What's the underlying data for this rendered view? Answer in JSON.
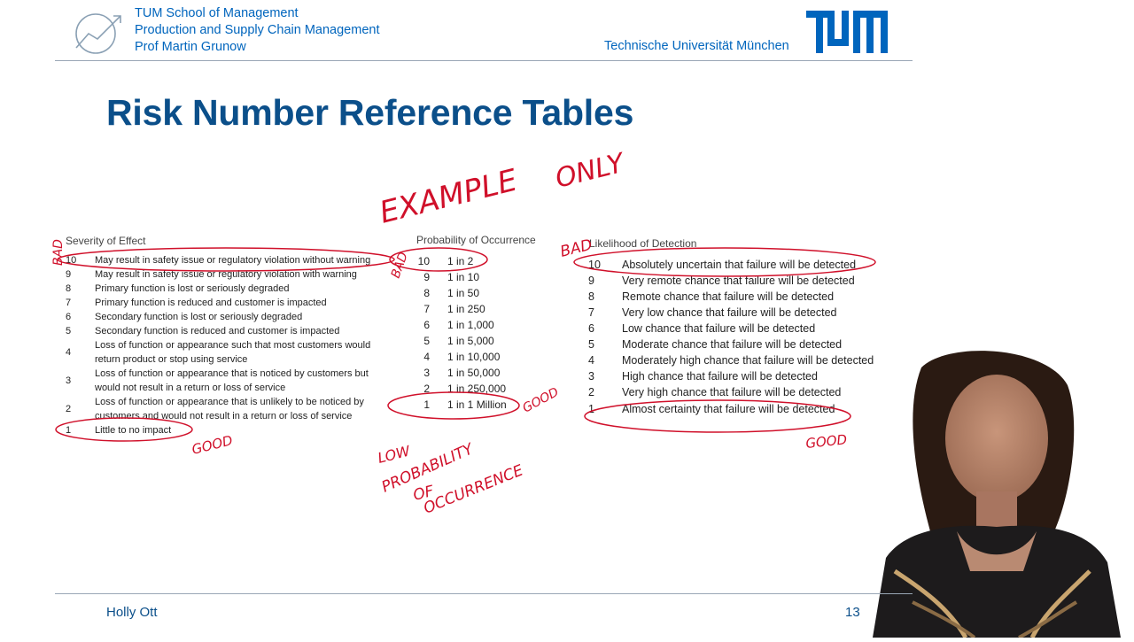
{
  "header": {
    "lines": [
      "TUM School of Management",
      "Production and Supply Chain Management",
      "Prof Martin Grunow"
    ],
    "university": "Technische Universität München",
    "logo_text": "TUM"
  },
  "title": "Risk Number Reference Tables",
  "severity": {
    "heading": "Severity of Effect",
    "rows": [
      {
        "n": "10",
        "t": "May result in safety issue or regulatory violation without warning"
      },
      {
        "n": "9",
        "t": "May result in safety issue or regulatory violation with warning"
      },
      {
        "n": "8",
        "t": "Primary function is lost or seriously degraded"
      },
      {
        "n": "7",
        "t": "Primary function is reduced and customer is impacted"
      },
      {
        "n": "6",
        "t": "Secondary function is lost or seriously degraded"
      },
      {
        "n": "5",
        "t": "Secondary function is reduced and customer is impacted"
      },
      {
        "n": "4",
        "t": "Loss of function or appearance such that most customers would return product or stop using service"
      },
      {
        "n": "3",
        "t": "Loss of function or appearance that is noticed by customers but would not result in a return or loss of service"
      },
      {
        "n": "2",
        "t": "Loss of function or appearance that is unlikely to be noticed by customers and would not result in a return or loss of service"
      },
      {
        "n": "1",
        "t": "Little to no impact"
      }
    ]
  },
  "probability": {
    "heading": "Probability of Occurrence",
    "rows": [
      {
        "n": "10",
        "t": "1 in 2"
      },
      {
        "n": "9",
        "t": "1 in 10"
      },
      {
        "n": "8",
        "t": "1 in 50"
      },
      {
        "n": "7",
        "t": "1 in 250"
      },
      {
        "n": "6",
        "t": "1 in 1,000"
      },
      {
        "n": "5",
        "t": "1 in 5,000"
      },
      {
        "n": "4",
        "t": "1 in 10,000"
      },
      {
        "n": "3",
        "t": "1 in 50,000"
      },
      {
        "n": "2",
        "t": "1 in 250,000"
      },
      {
        "n": "1",
        "t": "1 in 1 Million"
      }
    ]
  },
  "detection": {
    "heading": "Likelihood of Detection",
    "rows": [
      {
        "n": "10",
        "t": "Absolutely uncertain that failure will be detected"
      },
      {
        "n": "9",
        "t": "Very remote chance that failure will be detected"
      },
      {
        "n": "8",
        "t": "Remote chance that failure will be detected"
      },
      {
        "n": "7",
        "t": "Very low chance that failure will be detected"
      },
      {
        "n": "6",
        "t": "Low chance that failure will be detected"
      },
      {
        "n": "5",
        "t": "Moderate chance that failure will be detected"
      },
      {
        "n": "4",
        "t": "Moderately high chance that failure will be detected"
      },
      {
        "n": "3",
        "t": "High chance that failure will be detected"
      },
      {
        "n": "2",
        "t": "Very high chance that failure will be detected"
      },
      {
        "n": "1",
        "t": "Almost certainty that failure will be detected"
      }
    ]
  },
  "annotations": {
    "example_only_1": "EXAMPLE",
    "example_only_2": "ONLY",
    "bad": "BAD",
    "good": "GOOD",
    "low": "LOW",
    "probability": "PROBABILITY",
    "of": "OF",
    "occurrence": "OCCURRENCE"
  },
  "footer": {
    "presenter": "Holly Ott",
    "page": "13"
  },
  "colors": {
    "tum_blue": "#0065bd",
    "title_blue": "#0b4f8a",
    "ink_red": "#d0102a"
  }
}
